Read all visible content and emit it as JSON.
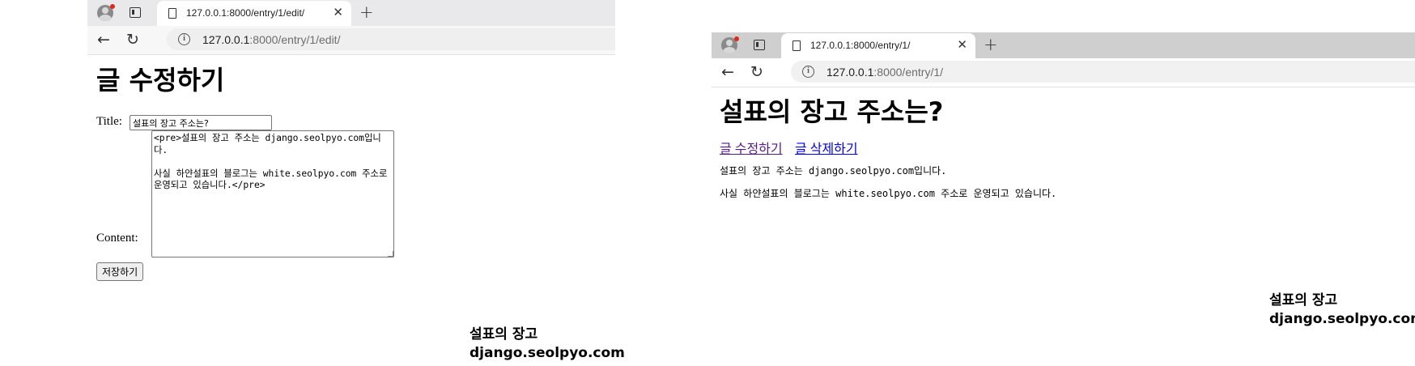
{
  "left_window": {
    "tab_title": "127.0.0.1:8000/entry/1/edit/",
    "tab_close": "✕",
    "new_tab": "+",
    "url_host": "127.0.0.1",
    "url_rest": ":8000/entry/1/edit/",
    "heading": "글 수정하기",
    "form": {
      "title_label": "Title:",
      "title_value": "설표의 장고 주소는?",
      "content_label": "Content:",
      "content_value": "<pre>설표의 장고 주소는 django.seolpyo.com입니다.\n\n사실 하얀설표의 블로그는 white.seolpyo.com 주소로 운영되고 있습니다.</pre>",
      "save_label": "저장하기"
    }
  },
  "right_window": {
    "tab_title": "127.0.0.1:8000/entry/1/",
    "tab_close": "✕",
    "new_tab": "+",
    "url_host": "127.0.0.1",
    "url_rest": ":8000/entry/1/",
    "heading": "설표의 장고 주소는?",
    "edit_link": "글 수정하기",
    "delete_link": "글 삭제하기",
    "paragraph_1": "설표의 장고 주소는 django.seolpyo.com입니다.",
    "paragraph_2": "사실 하얀설표의 블로그는 white.seolpyo.com 주소로 운영되고 있습니다."
  },
  "watermark": {
    "line1": "설표의 장고",
    "line2": "django.seolpyo.com"
  },
  "icons": {
    "profile": "profile-avatar-icon",
    "tab_actions": "tab-actions-icon",
    "page": "document-icon",
    "back": "back-arrow-icon",
    "reload": "reload-icon",
    "info": "info-icon"
  },
  "colors": {
    "visited_link": "#551a8b",
    "unvisited_link": "#0000ee",
    "profile_badge": "#e0281e"
  }
}
